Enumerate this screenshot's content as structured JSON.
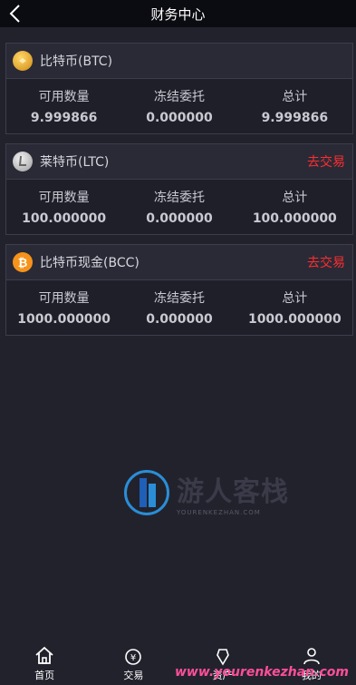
{
  "header": {
    "title": "财务中心"
  },
  "labels": {
    "available": "可用数量",
    "frozen": "冻结委托",
    "total": "总计"
  },
  "assets": [
    {
      "name": "比特币(BTC)",
      "trade_label": "",
      "available": "9.999866",
      "frozen": "0.000000",
      "total": "9.999866",
      "icon_color": "#e0a325"
    },
    {
      "name": "莱特币(LTC)",
      "trade_label": "去交易",
      "available": "100.000000",
      "frozen": "0.000000",
      "total": "100.000000",
      "icon_color": "#c8c8c8"
    },
    {
      "name": "比特币现金(BCC)",
      "trade_label": "去交易",
      "available": "1000.000000",
      "frozen": "0.000000",
      "total": "1000.000000",
      "icon_color": "#f7931a"
    }
  ],
  "watermark": {
    "cn": "游人客栈",
    "en": "YOURENKEZHAN.COM",
    "url": "www.yourenkezhan.com"
  },
  "tabs": [
    {
      "label": "首页",
      "icon": "home-icon"
    },
    {
      "label": "交易",
      "icon": "trade-icon"
    },
    {
      "label": "资产",
      "icon": "asset-icon"
    },
    {
      "label": "我的",
      "icon": "profile-icon"
    }
  ]
}
